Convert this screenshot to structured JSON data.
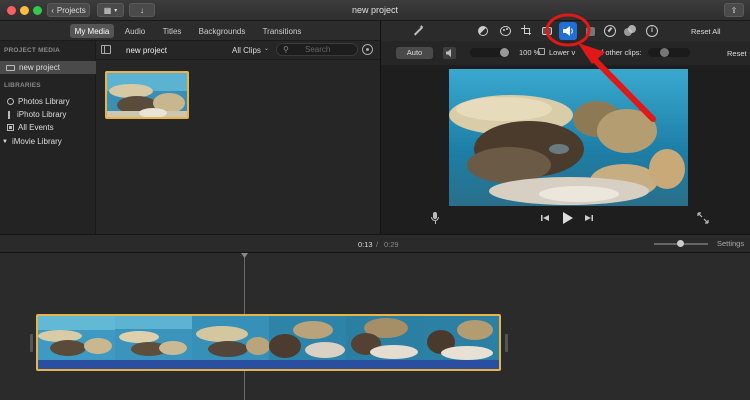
{
  "window": {
    "title": "new project"
  },
  "toolbar": {
    "projects_label": "Projects",
    "back_glyph": "‹",
    "media_glyph": "▦",
    "media_dropdown_glyph": "▾",
    "import_glyph": "↓",
    "share_glyph": "⇪"
  },
  "tabs": [
    {
      "label": "My Media",
      "active": true
    },
    {
      "label": "Audio",
      "active": false
    },
    {
      "label": "Titles",
      "active": false
    },
    {
      "label": "Backgrounds",
      "active": false
    },
    {
      "label": "Transitions",
      "active": false
    }
  ],
  "sidebar": {
    "section_project": "PROJECT MEDIA",
    "project_item": "new project",
    "section_libraries": "LIBRARIES",
    "libraries": [
      "Photos Library",
      "iPhoto Library",
      "All Events"
    ],
    "imovie_library": "iMovie Library"
  },
  "browser": {
    "project_title": "new project",
    "filter": "All Clips",
    "search_placeholder": "Search"
  },
  "adjust": {
    "reset_all": "Reset All",
    "auto": "Auto",
    "volume_percent": "100 %",
    "lower_volume_text": "Lower v",
    "other_clips_text": "of other clips:",
    "reset": "Reset"
  },
  "timeline": {
    "current_time": "0:13",
    "separator": "/",
    "total_time": "0:29",
    "settings": "Settings"
  },
  "colors": {
    "accent_clip_border": "#e8b44a",
    "annotation_red": "#e01818",
    "selected_tool": "#1f6fd6"
  },
  "icons": [
    "magic-wand-icon",
    "color-balance-icon",
    "color-correction-icon",
    "crop-icon",
    "stabilization-icon",
    "volume-icon",
    "noise-reduction-icon",
    "speed-icon",
    "filter-icon",
    "info-icon",
    "microphone-icon",
    "skip-back-icon",
    "play-icon",
    "skip-forward-icon",
    "fullscreen-icon"
  ]
}
